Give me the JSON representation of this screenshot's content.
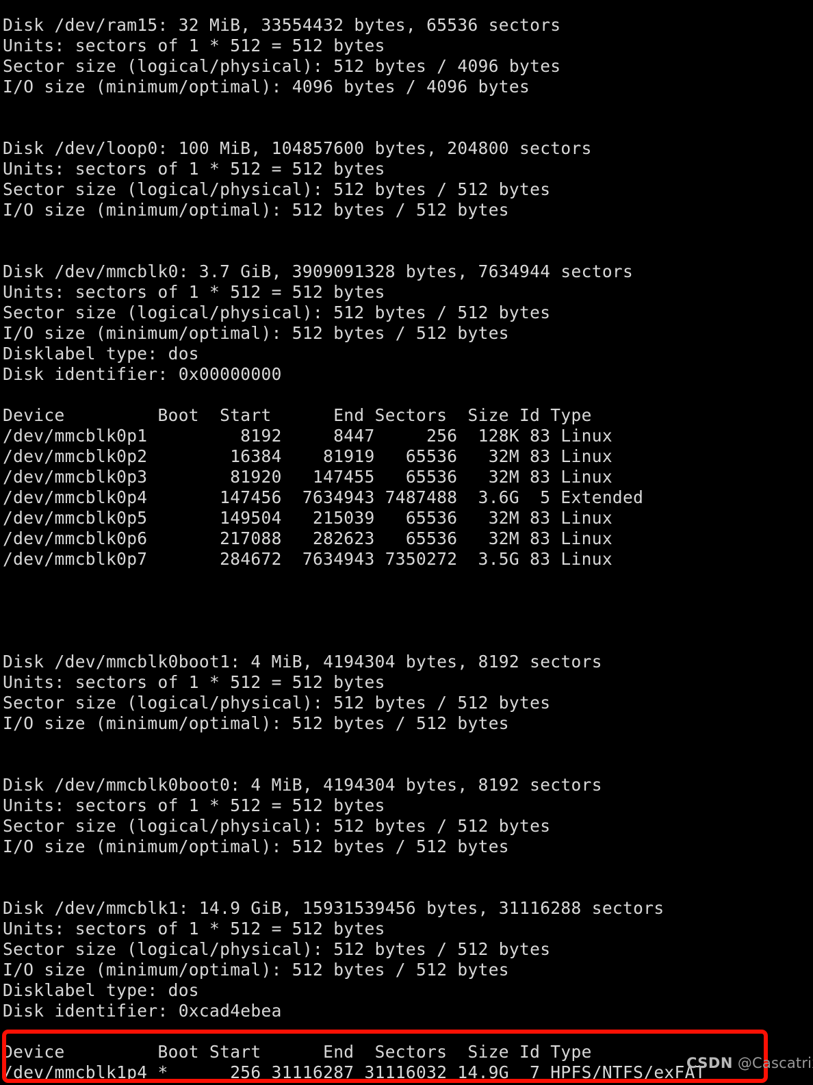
{
  "terminal": {
    "background_color": "#000000",
    "text_color": "#d8d8d8",
    "lines": [
      "Disk /dev/ram15: 32 MiB, 33554432 bytes, 65536 sectors",
      "Units: sectors of 1 * 512 = 512 bytes",
      "Sector size (logical/physical): 512 bytes / 4096 bytes",
      "I/O size (minimum/optimal): 4096 bytes / 4096 bytes",
      "",
      "",
      "Disk /dev/loop0: 100 MiB, 104857600 bytes, 204800 sectors",
      "Units: sectors of 1 * 512 = 512 bytes",
      "Sector size (logical/physical): 512 bytes / 512 bytes",
      "I/O size (minimum/optimal): 512 bytes / 512 bytes",
      "",
      "",
      "Disk /dev/mmcblk0: 3.7 GiB, 3909091328 bytes, 7634944 sectors",
      "Units: sectors of 1 * 512 = 512 bytes",
      "Sector size (logical/physical): 512 bytes / 512 bytes",
      "I/O size (minimum/optimal): 512 bytes / 512 bytes",
      "Disklabel type: dos",
      "Disk identifier: 0x00000000",
      "",
      "Device         Boot  Start      End Sectors  Size Id Type",
      "/dev/mmcblk0p1         8192     8447     256  128K 83 Linux",
      "/dev/mmcblk0p2        16384    81919   65536   32M 83 Linux",
      "/dev/mmcblk0p3        81920   147455   65536   32M 83 Linux",
      "/dev/mmcblk0p4       147456  7634943 7487488  3.6G  5 Extended",
      "/dev/mmcblk0p5       149504   215039   65536   32M 83 Linux",
      "/dev/mmcblk0p6       217088   282623   65536   32M 83 Linux",
      "/dev/mmcblk0p7       284672  7634943 7350272  3.5G 83 Linux",
      "",
      "",
      "",
      "",
      "Disk /dev/mmcblk0boot1: 4 MiB, 4194304 bytes, 8192 sectors",
      "Units: sectors of 1 * 512 = 512 bytes",
      "Sector size (logical/physical): 512 bytes / 512 bytes",
      "I/O size (minimum/optimal): 512 bytes / 512 bytes",
      "",
      "",
      "Disk /dev/mmcblk0boot0: 4 MiB, 4194304 bytes, 8192 sectors",
      "Units: sectors of 1 * 512 = 512 bytes",
      "Sector size (logical/physical): 512 bytes / 512 bytes",
      "I/O size (minimum/optimal): 512 bytes / 512 bytes",
      "",
      "",
      "Disk /dev/mmcblk1: 14.9 GiB, 15931539456 bytes, 31116288 sectors",
      "Units: sectors of 1 * 512 = 512 bytes",
      "Sector size (logical/physical): 512 bytes / 512 bytes",
      "I/O size (minimum/optimal): 512 bytes / 512 bytes",
      "Disklabel type: dos",
      "Disk identifier: 0xcad4ebea",
      "",
      "Device         Boot Start      End  Sectors  Size Id Type",
      "/dev/mmcblk1p4 *      256 31116287 31116032 14.9G  7 HPFS/NTFS/exFAT"
    ]
  },
  "disks": [
    {
      "device": "/dev/ram15",
      "size_human": "32 MiB",
      "size_bytes": "33554432 bytes",
      "sectors": "65536 sectors",
      "units": "sectors of 1 * 512 = 512 bytes",
      "sector_size": "512 bytes / 4096 bytes",
      "io_size": "4096 bytes / 4096 bytes"
    },
    {
      "device": "/dev/loop0",
      "size_human": "100 MiB",
      "size_bytes": "104857600 bytes",
      "sectors": "204800 sectors",
      "units": "sectors of 1 * 512 = 512 bytes",
      "sector_size": "512 bytes / 512 bytes",
      "io_size": "512 bytes / 512 bytes"
    },
    {
      "device": "/dev/mmcblk0",
      "size_human": "3.7 GiB",
      "size_bytes": "3909091328 bytes",
      "sectors": "7634944 sectors",
      "units": "sectors of 1 * 512 = 512 bytes",
      "sector_size": "512 bytes / 512 bytes",
      "io_size": "512 bytes / 512 bytes",
      "disklabel_type": "dos",
      "disk_identifier": "0x00000000",
      "partition_table": {
        "headers": [
          "Device",
          "Boot",
          "Start",
          "End",
          "Sectors",
          "Size",
          "Id",
          "Type"
        ],
        "rows": [
          [
            "/dev/mmcblk0p1",
            "",
            "8192",
            "8447",
            "256",
            "128K",
            "83",
            "Linux"
          ],
          [
            "/dev/mmcblk0p2",
            "",
            "16384",
            "81919",
            "65536",
            "32M",
            "83",
            "Linux"
          ],
          [
            "/dev/mmcblk0p3",
            "",
            "81920",
            "147455",
            "65536",
            "32M",
            "83",
            "Linux"
          ],
          [
            "/dev/mmcblk0p4",
            "",
            "147456",
            "7634943",
            "7487488",
            "3.6G",
            "5",
            "Extended"
          ],
          [
            "/dev/mmcblk0p5",
            "",
            "149504",
            "215039",
            "65536",
            "32M",
            "83",
            "Linux"
          ],
          [
            "/dev/mmcblk0p6",
            "",
            "217088",
            "282623",
            "65536",
            "32M",
            "83",
            "Linux"
          ],
          [
            "/dev/mmcblk0p7",
            "",
            "284672",
            "7634943",
            "7350272",
            "3.5G",
            "83",
            "Linux"
          ]
        ]
      }
    },
    {
      "device": "/dev/mmcblk0boot1",
      "size_human": "4 MiB",
      "size_bytes": "4194304 bytes",
      "sectors": "8192 sectors",
      "units": "sectors of 1 * 512 = 512 bytes",
      "sector_size": "512 bytes / 512 bytes",
      "io_size": "512 bytes / 512 bytes"
    },
    {
      "device": "/dev/mmcblk0boot0",
      "size_human": "4 MiB",
      "size_bytes": "4194304 bytes",
      "sectors": "8192 sectors",
      "units": "sectors of 1 * 512 = 512 bytes",
      "sector_size": "512 bytes / 512 bytes",
      "io_size": "512 bytes / 512 bytes"
    },
    {
      "device": "/dev/mmcblk1",
      "size_human": "14.9 GiB",
      "size_bytes": "15931539456 bytes",
      "sectors": "31116288 sectors",
      "units": "sectors of 1 * 512 = 512 bytes",
      "sector_size": "512 bytes / 512 bytes",
      "io_size": "512 bytes / 512 bytes",
      "disklabel_type": "dos",
      "disk_identifier": "0xcad4ebea",
      "partition_table": {
        "headers": [
          "Device",
          "Boot",
          "Start",
          "End",
          "Sectors",
          "Size",
          "Id",
          "Type"
        ],
        "rows": [
          [
            "/dev/mmcblk1p4",
            "*",
            "256",
            "31116287",
            "31116032",
            "14.9G",
            "7",
            "HPFS/NTFS/exFAT"
          ]
        ]
      }
    }
  ],
  "annotation": {
    "highlight_color": "#fc1004",
    "highlight_target": "mmcblk1 partition table"
  },
  "watermark": {
    "brand": "CSDN",
    "handle": "@Cascatrix"
  }
}
